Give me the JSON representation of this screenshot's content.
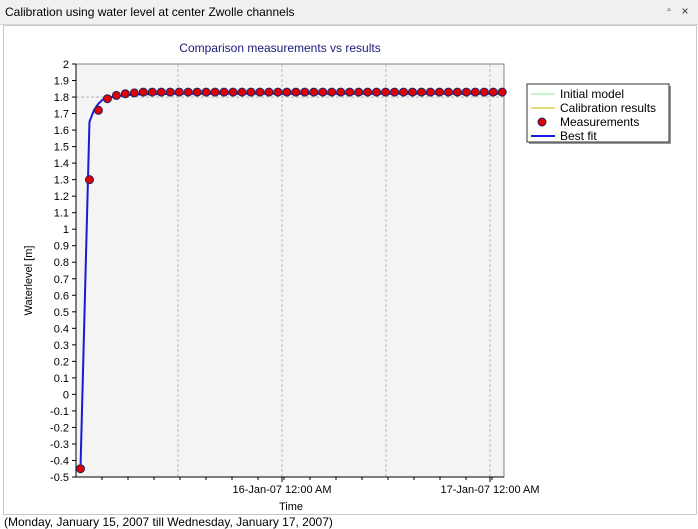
{
  "window": {
    "title": "Calibration using water level at center Zwolle channels",
    "pin_icon": "pin-icon",
    "close_icon": "close-icon",
    "pin_glyph": "▫",
    "close_glyph": "×"
  },
  "status": {
    "date_range": "(Monday, January 15, 2007 till Wednesday, January 17, 2007)"
  },
  "chart_data": {
    "type": "line",
    "title": "Comparison measurements vs results",
    "xlabel": "Time",
    "ylabel": "Waterlevel [m]",
    "x_unit": "hours after 15-Jan-07 00:00",
    "xlim": [
      11.1,
      58.8
    ],
    "ylim": [
      -0.5,
      2
    ],
    "y_ticks": [
      -0.5,
      -0.4,
      -0.3,
      -0.2,
      -0.1,
      0,
      0.1,
      0.2,
      0.3,
      0.4,
      0.5,
      0.6,
      0.7,
      0.8,
      0.9,
      1,
      1.1,
      1.2,
      1.3,
      1.4,
      1.5,
      1.6,
      1.7,
      1.8,
      1.9,
      2
    ],
    "x_tick_labels": [
      {
        "x": 34.2,
        "label": ""
      },
      {
        "x": 46,
        "label": ""
      },
      {
        "x": 57.9,
        "label": ""
      },
      {
        "x": 22.5,
        "label": ""
      },
      {
        "x": 34.5,
        "label": ""
      },
      {
        "x": 46.5,
        "label": ""
      },
      {
        "x": 58.5,
        "label": ""
      },
      {
        "x": 36,
        "label": "16-Jan-07 12:00 AM"
      },
      {
        "x": 60,
        "label": "17-Jan-07 12:00 AM"
      }
    ],
    "grid": true,
    "legend_position": "right",
    "colors": {
      "initial_model": "#90ee90",
      "calibration_results": "#c8b400",
      "measurements_fill": "#e00000",
      "measurements_edge": "#222266",
      "best_fit": "#1a1ad6"
    },
    "series": [
      {
        "name": "Initial model",
        "kind": "line",
        "x": [],
        "y": []
      },
      {
        "name": "Calibration results",
        "kind": "line",
        "x": [],
        "y": []
      },
      {
        "name": "Measurements",
        "kind": "points",
        "x": [
          11.6,
          12.6,
          13.6,
          14.6,
          15.6,
          16.6,
          17.6,
          18.6,
          19.6,
          20.6,
          21.6,
          22.6,
          23.6,
          24.6,
          25.6,
          26.6,
          27.6,
          28.6,
          29.6,
          30.6,
          31.6,
          32.6,
          33.6,
          34.6,
          35.6,
          36.6,
          37.6,
          38.6,
          39.6,
          40.6,
          41.6,
          42.6,
          43.6,
          44.6,
          45.6,
          46.6,
          47.6,
          48.6,
          49.6,
          50.6,
          51.6,
          52.6,
          53.6,
          54.6,
          55.6,
          56.6,
          57.6,
          58.6
        ],
        "y": [
          -0.45,
          1.3,
          1.72,
          1.79,
          1.81,
          1.82,
          1.825,
          1.83,
          1.83,
          1.83,
          1.83,
          1.83,
          1.83,
          1.83,
          1.83,
          1.83,
          1.83,
          1.83,
          1.83,
          1.83,
          1.83,
          1.83,
          1.83,
          1.83,
          1.83,
          1.83,
          1.83,
          1.83,
          1.83,
          1.83,
          1.83,
          1.83,
          1.83,
          1.83,
          1.83,
          1.83,
          1.83,
          1.83,
          1.83,
          1.83,
          1.83,
          1.83,
          1.83,
          1.83,
          1.83,
          1.83,
          1.83,
          1.83
        ]
      },
      {
        "name": "Best fit",
        "kind": "line",
        "x": [
          11.6,
          12.1,
          12.6,
          13.1,
          13.6,
          14.1,
          14.6,
          15.6,
          16.6,
          17.6,
          19.6,
          22.6,
          30,
          40,
          50,
          58.8
        ],
        "y": [
          -0.45,
          0.6,
          1.65,
          1.72,
          1.76,
          1.785,
          1.795,
          1.805,
          1.81,
          1.815,
          1.818,
          1.82,
          1.82,
          1.82,
          1.82,
          1.82
        ]
      }
    ]
  }
}
